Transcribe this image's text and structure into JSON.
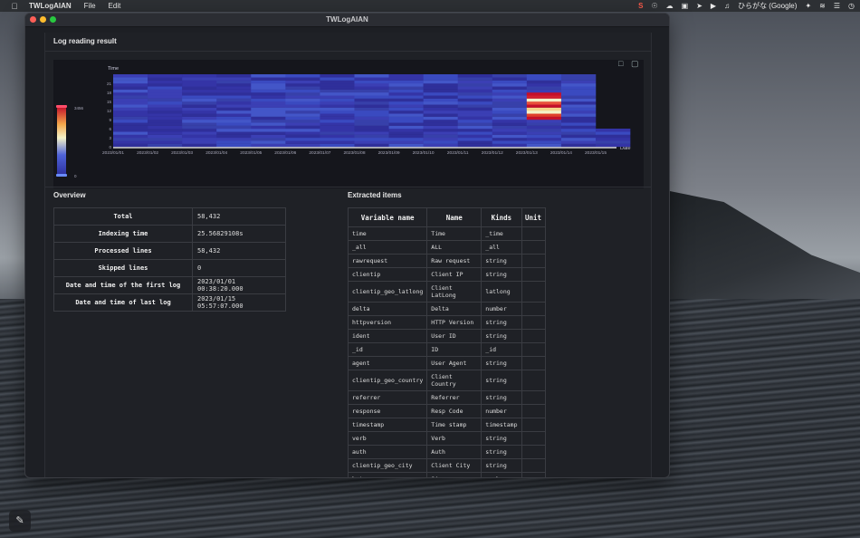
{
  "menubar": {
    "app_name": "TWLogAIAN",
    "menus": [
      "File",
      "Edit"
    ],
    "input_method": "ひらがな (Google)"
  },
  "window": {
    "title": "TWLogAIAN"
  },
  "result": {
    "title": "Log reading result",
    "chart_data": {
      "type": "heatmap",
      "ylabel": "Time",
      "xlabel": "Date",
      "y_ticks": [
        "0",
        "3",
        "6",
        "9",
        "12",
        "15",
        "18",
        "21"
      ],
      "x_ticks": [
        "2023/01/01",
        "2023/01/02",
        "2023/01/03",
        "2023/01/04",
        "2023/01/05",
        "2023/01/06",
        "2023/01/07",
        "2023/01/08",
        "2023/01/09",
        "2023/01/10",
        "2023/01/11",
        "2023/01/12",
        "2023/01/13",
        "2023/01/14",
        "2023/01/15"
      ],
      "colorscale": {
        "min": 0,
        "max": 3456,
        "min_label": "0",
        "max_label": "3456"
      },
      "hot_day_index": 12,
      "hot_hours_range": [
        9,
        17
      ],
      "last_day_hours": [
        0,
        5
      ]
    }
  },
  "overview": {
    "title": "Overview",
    "rows": [
      {
        "key": "Total",
        "value": "58,432"
      },
      {
        "key": "Indexing time",
        "value": "25.56829108s"
      },
      {
        "key": "Processed lines",
        "value": "58,432"
      },
      {
        "key": "Skipped lines",
        "value": "0"
      },
      {
        "key": "Date and time of the first log",
        "value": "2023/01/01 00:38:20.000"
      },
      {
        "key": "Date and time of last log",
        "value": "2023/01/15 05:57:07.000"
      }
    ]
  },
  "extracted": {
    "title": "Extracted items",
    "headers": [
      "Variable name",
      "Name",
      "Kinds",
      "Unit"
    ],
    "rows": [
      [
        "time",
        "Time",
        "_time",
        ""
      ],
      [
        "_all",
        "ALL",
        "_all",
        ""
      ],
      [
        "rawrequest",
        "Raw request",
        "string",
        ""
      ],
      [
        "clientip",
        "Client IP",
        "string",
        ""
      ],
      [
        "clientip_geo_latlong",
        "Client LatLong",
        "latlong",
        ""
      ],
      [
        "delta",
        "Delta",
        "number",
        ""
      ],
      [
        "httpversion",
        "HTTP Version",
        "string",
        ""
      ],
      [
        "ident",
        "User ID",
        "string",
        ""
      ],
      [
        "_id",
        "ID",
        "_id",
        ""
      ],
      [
        "agent",
        "User Agent",
        "string",
        ""
      ],
      [
        "clientip_geo_country",
        "Client Country",
        "string",
        ""
      ],
      [
        "referrer",
        "Referrer",
        "string",
        ""
      ],
      [
        "response",
        "Resp Code",
        "number",
        ""
      ],
      [
        "timestamp",
        "Time stamp",
        "timestamp",
        ""
      ],
      [
        "verb",
        "Verb",
        "string",
        ""
      ],
      [
        "auth",
        "Auth",
        "string",
        ""
      ],
      [
        "clientip_geo_city",
        "Client City",
        "string",
        ""
      ],
      [
        "bytes",
        "Size",
        "number",
        ""
      ]
    ]
  }
}
